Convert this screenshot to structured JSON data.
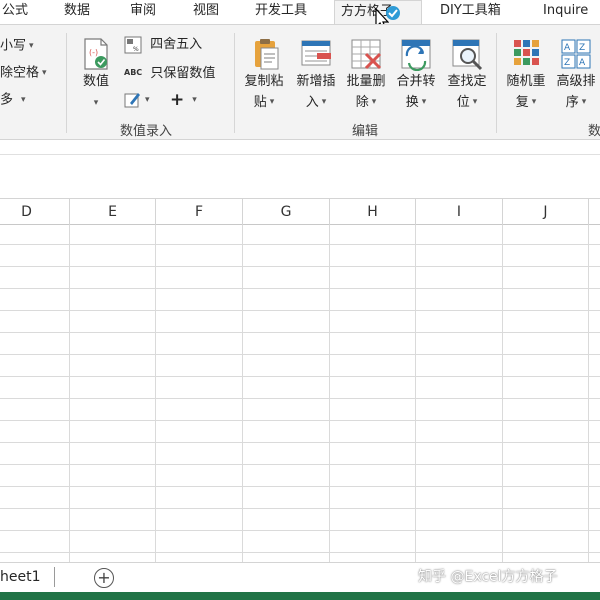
{
  "tabs": {
    "formulas": "公式",
    "data": "数据",
    "review": "审阅",
    "view": "视图",
    "developer": "开发工具",
    "fangfang": "方方格子",
    "diy": "DIY工具箱",
    "inquire": "Inquire"
  },
  "ribbon": {
    "left": {
      "case": "小写",
      "trim_spaces": "除空格",
      "more": "多"
    },
    "numeric": {
      "value_btn": "数值",
      "round": "四舍五入",
      "keep_value": "只保留数值",
      "abc_badge": "ABC",
      "group_label": "数值录入"
    },
    "edit": {
      "copy_paste": [
        "复制粘",
        "贴"
      ],
      "add_insert": [
        "新增插",
        "入"
      ],
      "batch_delete": [
        "批量删",
        "除"
      ],
      "merge_convert": [
        "合并转",
        "换"
      ],
      "find_locate": [
        "查找定",
        "位"
      ],
      "group_label": "编辑"
    },
    "data_group": {
      "random_repeat": [
        "随机重",
        "复"
      ],
      "advanced_sort": [
        "高级排",
        "序"
      ],
      "group_label": "数"
    }
  },
  "columns": [
    "D",
    "E",
    "F",
    "G",
    "H",
    "I",
    "J"
  ],
  "sheet": {
    "tab_label": "heet1",
    "add_symbol": "+"
  },
  "watermark": "知乎 @Excel方方格子",
  "colors": {
    "accent_green": "#217346",
    "ribbon_bg": "#f3f3f3",
    "icon_red": "#d9534f",
    "icon_blue": "#2e75b6",
    "icon_orange": "#e6a23c"
  },
  "icons": [
    "format-icon",
    "plus-icon",
    "copy-paste-icon",
    "insert-icon",
    "batch-delete-icon",
    "merge-convert-icon",
    "find-icon",
    "random-icon",
    "sort-icon",
    "add-sheet-icon"
  ]
}
